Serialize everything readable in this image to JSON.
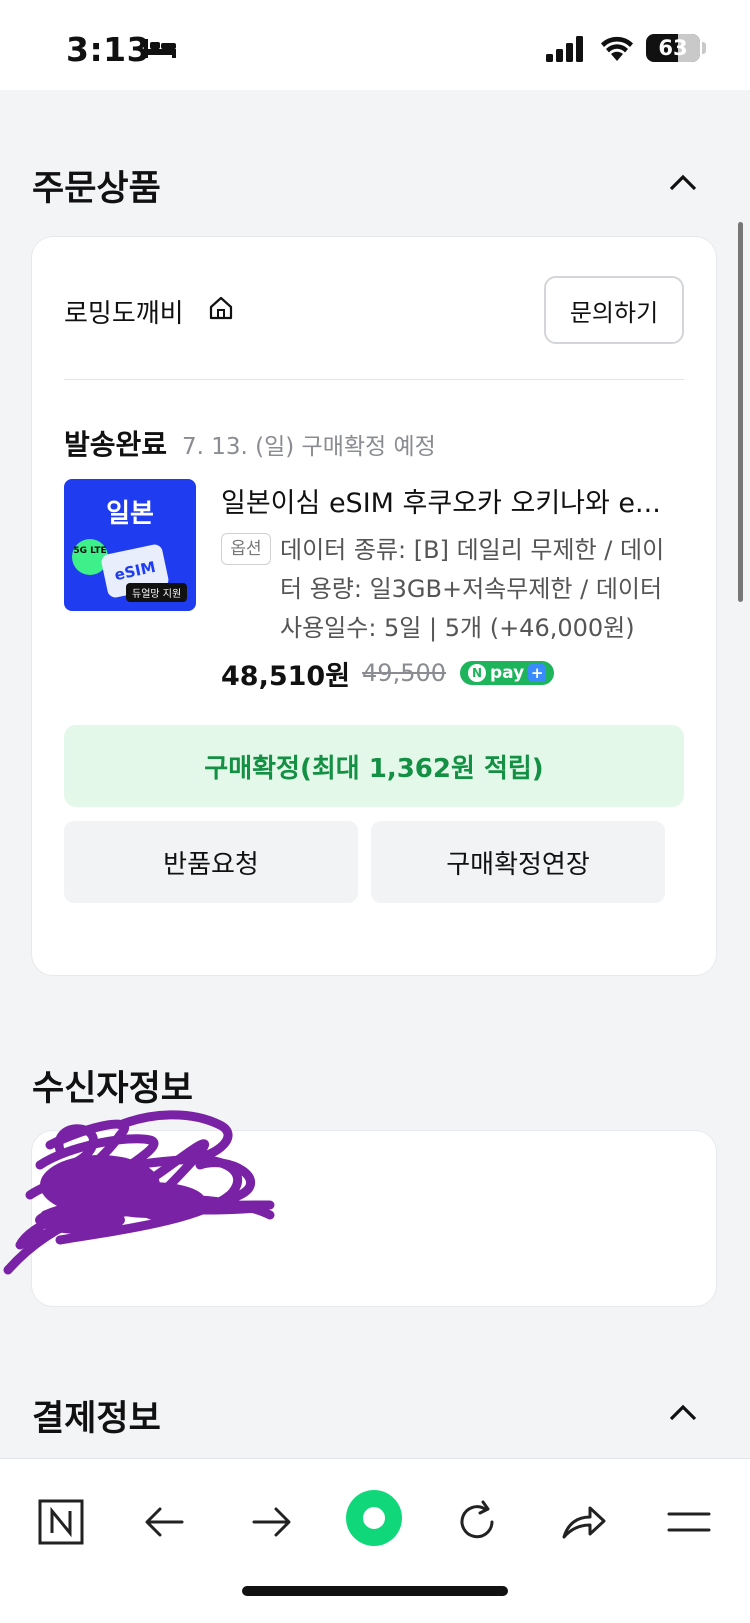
{
  "status_bar": {
    "time": "3:13",
    "battery": "63"
  },
  "order": {
    "section_title": "주문상품",
    "seller": {
      "name": "로밍도깨비",
      "inquiry_label": "문의하기"
    },
    "shipping": {
      "status": "발송완료",
      "date_note": "7. 13. (일) 구매확정 예정"
    },
    "product": {
      "thumb_title": "일본",
      "thumb_badge": "5G LTE",
      "thumb_card": "eSIM",
      "thumb_tag": "듀얼망 지원",
      "name": "일본이심 eSIM 후쿠오카 오키나와 e...",
      "option_tag": "옵션",
      "option_text": "데이터 종류: [B] 데일리 무제한 / 데이터 용량: 일3GB+저속무제한 / 데이터 사용일수: 5일 | 5개 (+46,000원)",
      "price_final": "48,510원",
      "price_original": "49,500",
      "npay_label": "pay"
    },
    "confirm_label": "구매확정(최대 1,362원 적립)",
    "return_label": "반품요청",
    "extend_label": "구매확정연장"
  },
  "recipient": {
    "section_title": "수신자정보"
  },
  "payment": {
    "section_title": "결제정보"
  },
  "colors": {
    "accent_green": "#139043",
    "confirm_bg": "#e3f8e9",
    "npay_green": "#1db45c",
    "thumb_blue": "#1f3cf0",
    "scribble_purple": "#7a22a6"
  },
  "icons": [
    "bed-icon",
    "signal-icon",
    "wifi-icon",
    "home-icon",
    "chevron-up-icon",
    "naver-n-icon",
    "back-arrow-icon",
    "forward-arrow-icon",
    "green-dot-icon",
    "refresh-icon",
    "share-icon",
    "menu-icon"
  ]
}
